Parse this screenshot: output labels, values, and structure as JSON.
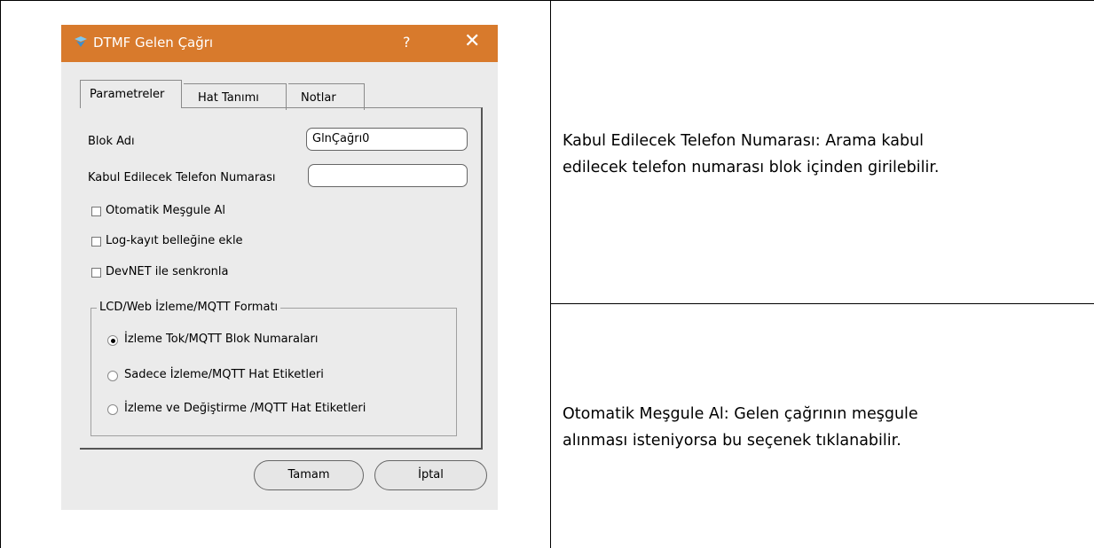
{
  "dialog": {
    "title": "DTMF Gelen Çağrı",
    "help_label": "?",
    "close_label": "✕",
    "icon": "dtmf-app-icon",
    "tabs": [
      {
        "label": "Parametreler",
        "active": true
      },
      {
        "label": "Hat Tanımı",
        "active": false
      },
      {
        "label": "Notlar",
        "active": false
      }
    ],
    "fields": {
      "block_name_label": "Blok Adı",
      "block_name_value": "GlnÇağrı0",
      "phone_label": "Kabul Edilecek Telefon Numarası",
      "phone_value": ""
    },
    "checkboxes": [
      {
        "label": "Otomatik Meşgule Al",
        "checked": false
      },
      {
        "label": "Log-kayıt belleğine ekle",
        "checked": false
      },
      {
        "label": "DevNET ile senkronla",
        "checked": false
      }
    ],
    "group": {
      "legend": "LCD/Web İzleme/MQTT Formatı",
      "options": [
        {
          "label": "İzleme Tok/MQTT Blok Numaraları",
          "selected": true
        },
        {
          "label": "Sadece İzleme/MQTT Hat Etiketleri",
          "selected": false
        },
        {
          "label": "İzleme ve Değiştirme /MQTT Hat Etiketleri",
          "selected": false
        }
      ]
    },
    "buttons": {
      "ok": "Tamam",
      "cancel": "İptal"
    },
    "colors": {
      "titlebar": "#d87a2c",
      "body": "#ebebeb"
    }
  },
  "descriptions": [
    {
      "line1": "Kabul Edilecek Telefon Numarası:  Arama kabul",
      "line2": "edilecek telefon numarası blok içinden girilebilir."
    },
    {
      "line1": "Otomatik Meşgule Al:   Gelen çağrının meşgule",
      "line2": "alınması isteniyorsa bu seçenek tıklanabilir."
    }
  ]
}
